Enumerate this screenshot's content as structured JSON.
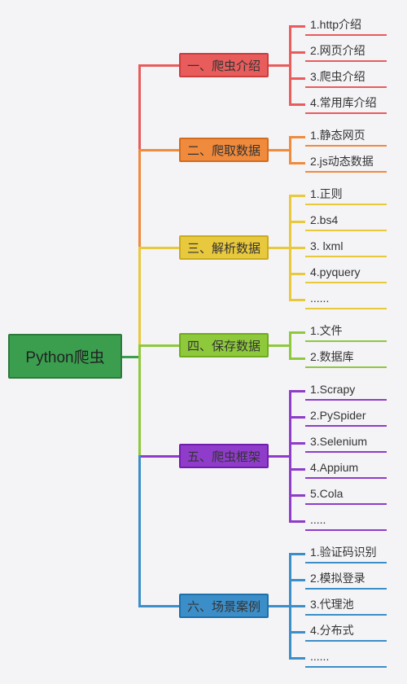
{
  "root": {
    "label": "Python爬虫"
  },
  "branches": [
    {
      "label": "一、爬虫介绍",
      "color": "#e85c5c",
      "leaves": [
        "1.http介绍",
        "2.网页介绍",
        "3.爬虫介绍",
        "4.常用库介绍"
      ]
    },
    {
      "label": "二、爬取数据",
      "color": "#f08a3c",
      "leaves": [
        "1.静态网页",
        "2.js动态数据"
      ]
    },
    {
      "label": "三、解析数据",
      "color": "#e8c83c",
      "leaves": [
        "1.正则",
        "2.bs4",
        "3. lxml",
        "4.pyquery",
        "......"
      ]
    },
    {
      "label": "四、保存数据",
      "color": "#8ec93c",
      "leaves": [
        "1.文件",
        "2.数据库"
      ]
    },
    {
      "label": "五、爬虫框架",
      "color": "#8e3cc9",
      "leaves": [
        "1.Scrapy",
        "2.PySpider",
        "3.Selenium",
        "4.Appium",
        "5.Cola",
        "....."
      ]
    },
    {
      "label": "六、场景案例",
      "color": "#3c8ec9",
      "leaves": [
        "1.验证码识别",
        "2.模拟登录",
        "3.代理池",
        "4.分布式",
        "......"
      ]
    }
  ]
}
